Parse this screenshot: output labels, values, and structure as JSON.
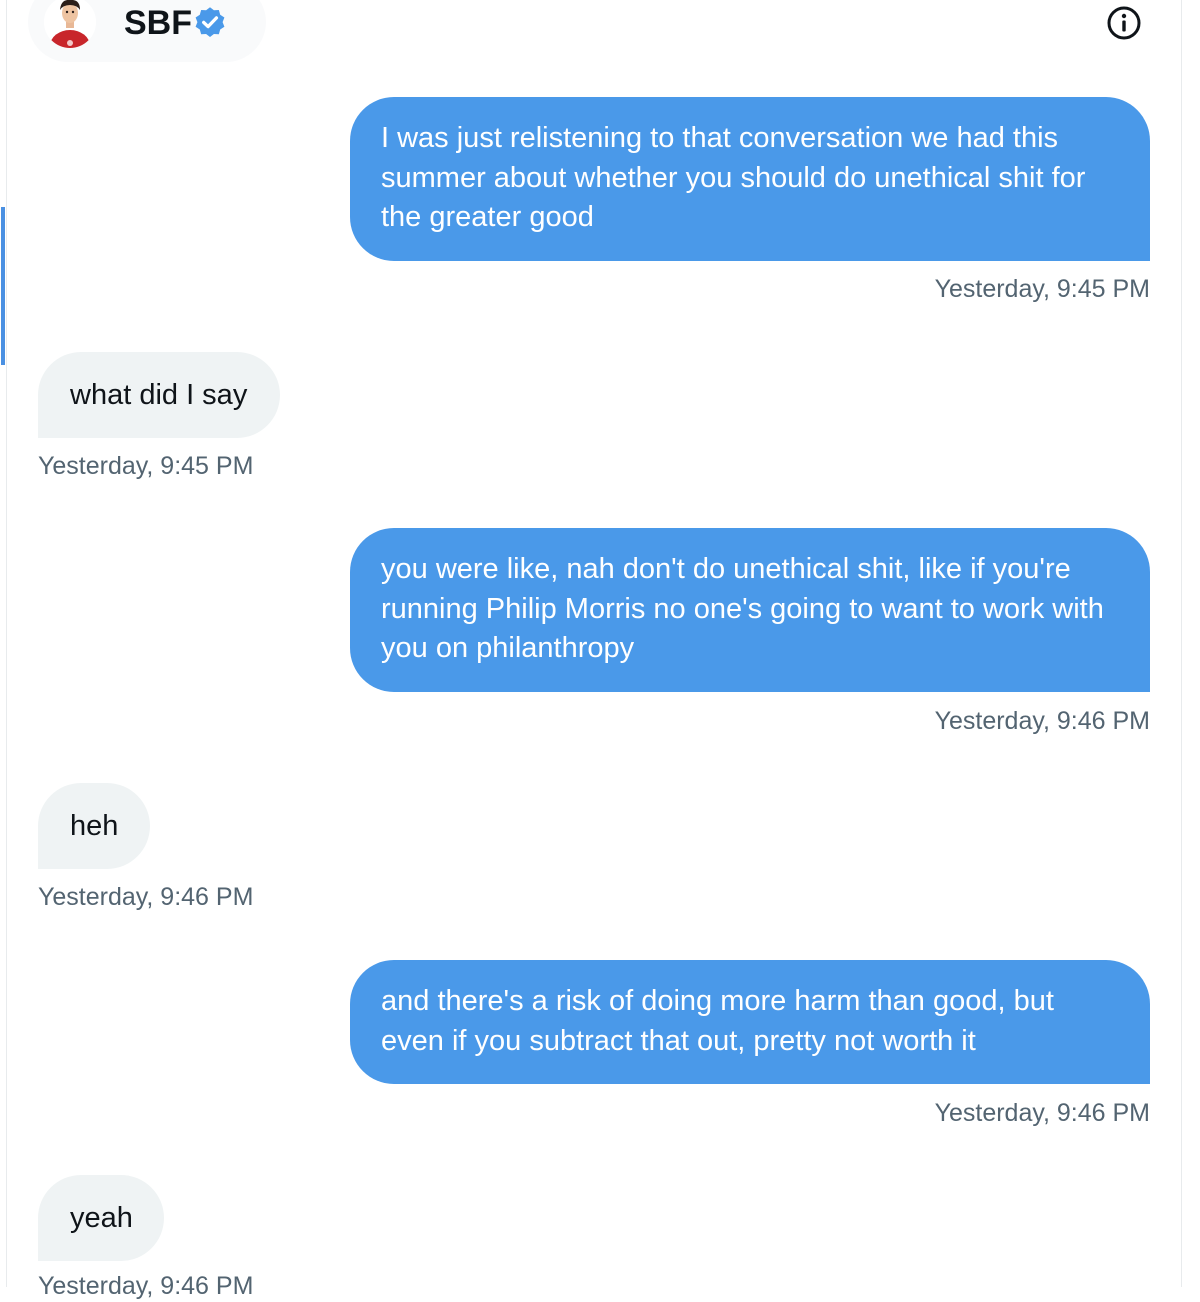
{
  "header": {
    "name": "SBF",
    "verified": true,
    "avatar_icon": "avatar-icon",
    "info_icon": "info-icon"
  },
  "colors": {
    "outgoing_bubble": "#4a99e9",
    "incoming_bubble": "#eff3f4",
    "timestamp": "#536471",
    "verified_badge": "#4a99e9"
  },
  "messages": [
    {
      "direction": "outgoing",
      "lines": [
        "I was just relistening to that conversation we had this",
        "summer about whether you should do unethical shit for",
        "the greater good"
      ],
      "timestamp": "Yesterday, 9:45 PM"
    },
    {
      "direction": "incoming",
      "text": "what did I say",
      "timestamp": "Yesterday, 9:45 PM"
    },
    {
      "direction": "outgoing",
      "lines": [
        "you were like, nah don't do unethical shit, like if you're",
        "running Philip Morris no one's going to want to work with",
        "you on philanthropy"
      ],
      "timestamp": "Yesterday, 9:46 PM"
    },
    {
      "direction": "incoming",
      "text": "heh",
      "timestamp": "Yesterday, 9:46 PM"
    },
    {
      "direction": "outgoing",
      "lines": [
        "and there's a risk of doing more harm than good, but",
        "even if you subtract that out, pretty not worth it"
      ],
      "timestamp": "Yesterday, 9:46 PM"
    },
    {
      "direction": "incoming",
      "text": "yeah",
      "timestamp": "Yesterday, 9:46 PM"
    }
  ]
}
